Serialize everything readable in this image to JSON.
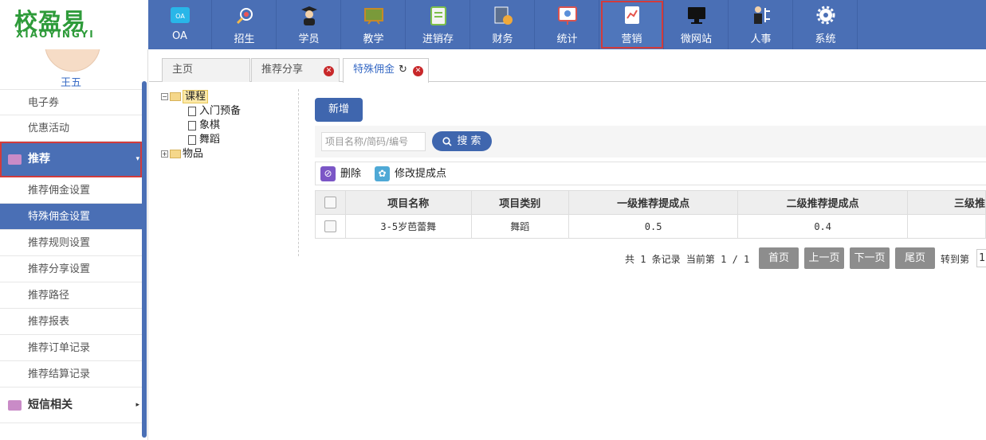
{
  "logo": {
    "main": "校盈易",
    "sub": "XIAOYINGYI"
  },
  "nav": [
    {
      "label": "OA",
      "icon": "oa-icon"
    },
    {
      "label": "招生",
      "icon": "recruit-icon"
    },
    {
      "label": "学员",
      "icon": "student-icon"
    },
    {
      "label": "教学",
      "icon": "teaching-icon"
    },
    {
      "label": "进销存",
      "icon": "inventory-icon"
    },
    {
      "label": "财务",
      "icon": "finance-icon"
    },
    {
      "label": "统计",
      "icon": "statistics-icon"
    },
    {
      "label": "营销",
      "icon": "marketing-icon"
    },
    {
      "label": "微网站",
      "icon": "microsite-icon"
    },
    {
      "label": "人事",
      "icon": "personnel-icon"
    },
    {
      "label": "系统",
      "icon": "settings-gear-icon"
    }
  ],
  "sidebar": {
    "username": "王五",
    "pre_items": [
      "电子券",
      "优惠活动"
    ],
    "group": "推荐",
    "items": [
      "推荐佣金设置",
      "特殊佣金设置",
      "推荐规则设置",
      "推荐分享设置",
      "推荐路径",
      "推荐报表",
      "推荐订单记录",
      "推荐结算记录"
    ],
    "next_group": "短信相关"
  },
  "tabs": [
    {
      "label": "主页"
    },
    {
      "label": "推荐分享"
    },
    {
      "label": "特殊佣金"
    }
  ],
  "tree": {
    "root": "课程",
    "children": [
      "入门预备",
      "象棋",
      "舞蹈"
    ],
    "root2": "物品"
  },
  "main": {
    "add_label": "新增",
    "search_placeholder": "项目名称/简码/编号",
    "search_label": "搜 索",
    "delete_label": "删除",
    "edit_label": "修改提成点"
  },
  "table": {
    "headers": [
      "项目名称",
      "项目类别",
      "一级推荐提成点",
      "二级推荐提成点",
      "三级推"
    ],
    "rows": [
      [
        "3-5岁芭蕾舞",
        "舞蹈",
        "0.5",
        "0.4",
        ""
      ]
    ]
  },
  "pager": {
    "summary": "共 1 条记录 当前第 1 / 1",
    "first": "首页",
    "prev": "上一页",
    "next": "下一页",
    "last": "尾页",
    "goto": "转到第",
    "goto_value": "1"
  }
}
